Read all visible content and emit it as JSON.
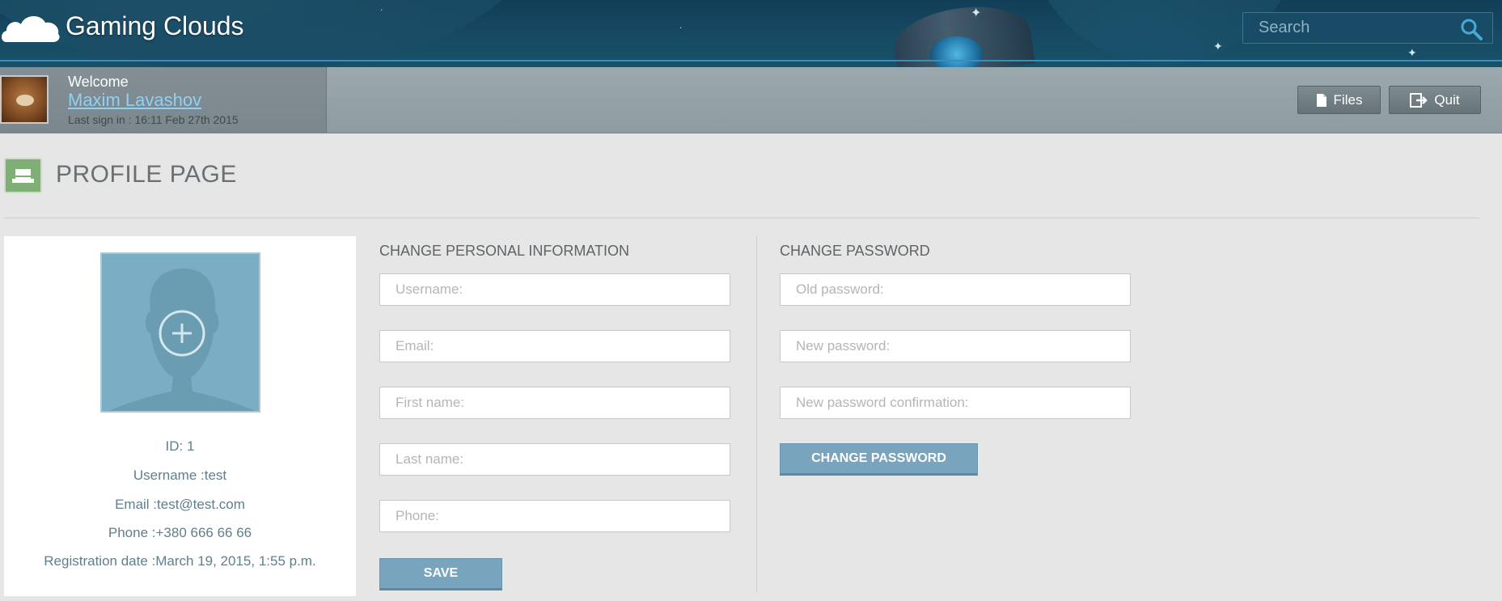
{
  "header": {
    "brand": "Gaming Clouds",
    "search_placeholder": "Search"
  },
  "user": {
    "welcome": "Welcome",
    "name": "Maxim Lavashov",
    "last_sign": "Last sign in : 16:11 Feb 27th 2015"
  },
  "toolbar": {
    "files_label": "Files",
    "quit_label": "Quit"
  },
  "page": {
    "title": "PROFILE PAGE"
  },
  "profile": {
    "id": "ID: 1",
    "username": "Username :test",
    "email": "Email :test@test.com",
    "phone": "Phone :+380 666 66 66",
    "registration": "Registration date :March 19, 2015, 1:55 p.m."
  },
  "personal_form": {
    "title": "CHANGE PERSONAL INFORMATION",
    "username_placeholder": "Username:",
    "email_placeholder": "Email:",
    "first_name_placeholder": "First name:",
    "last_name_placeholder": "Last name:",
    "phone_placeholder": "Phone:",
    "save_label": "SAVE"
  },
  "password_form": {
    "title": "CHANGE PASSWORD",
    "old_placeholder": "Old password:",
    "new_placeholder": "New password:",
    "confirm_placeholder": "New password confirmation:",
    "submit_label": "CHANGE PASSWORD"
  },
  "icons": {
    "logo": "cloud-icon",
    "search": "search-icon",
    "files": "file-icon",
    "quit": "exit-icon",
    "page": "hat-icon",
    "photo_add": "plus-circle-icon"
  },
  "colors": {
    "header_bg": "#174a64",
    "accent_button": "#78a5bd",
    "link": "#8ed1f5",
    "page_icon": "#7fae77"
  }
}
